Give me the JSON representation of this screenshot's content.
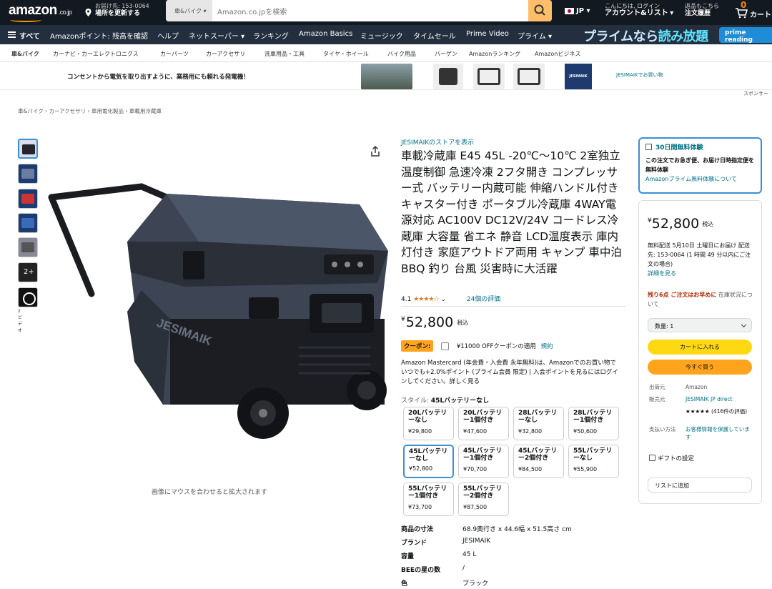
{
  "header": {
    "logo": "amazon",
    "logo_suffix": ".co.jp",
    "deliver_line1": "お届け先: 153-0064",
    "deliver_line2": "場所を更新する",
    "search_category": "車&バイク",
    "search_placeholder": "Amazon.co.jpを検索",
    "language": "JP",
    "account_line1": "こんにちは, ログイン",
    "account_line2": "アカウント&リスト",
    "orders_line1": "返品もこちら",
    "orders_line2": "注文履歴",
    "cart_count": "0",
    "cart_label": "カート"
  },
  "nav": {
    "all": "すべて",
    "items": [
      "Amazonポイント: 残高を確認",
      "ヘルプ",
      "ネットスーパー",
      "ランキング",
      "Amazon Basics",
      "ミュージック",
      "タイムセール",
      "Prime Video",
      "プライム"
    ],
    "promo_a": "プライムなら",
    "promo_b": "読み放題",
    "promo_badge": "prime reading"
  },
  "subnav": [
    "車&バイク",
    "カーナビ・カーエレクトロニクス",
    "カーパーツ",
    "カーアクセサリ",
    "洗車用品・工具",
    "タイヤ・ホイール",
    "バイク用品",
    "バーゲン",
    "Amazonランキング",
    "Amazonビジネス"
  ],
  "ad": {
    "text": "コンセントから電気を取り出すように、業務用にも頼れる発電機！",
    "brand": "JESIMAIK",
    "shop_link": "JESIMAIKでお買い物",
    "sponsored": "スポンサー"
  },
  "breadcrumb": "車&バイク › カーアクセサリ › 車用電化製品 › 車載用冷蔵庫",
  "gallery": {
    "video_label": "2 ビデオ",
    "more_count": "2+",
    "hover_hint": "画像にマウスを合わせると拡大されます"
  },
  "product": {
    "store_link": "JESIMAIKのストアを表示",
    "title": "車載冷蔵庫 E45 45L -20℃～10℃ 2室独立温度制御 急速冷凍 2フタ開き コンプレッサー式 バッテリー内蔵可能 伸縮ハンドル付き キャスター付き ポータブル冷蔵庫 4WAY電源対応 AC100V DC12V/24V コードレス冷蔵庫 大容量 省エネ 静音 LCD温度表示 庫内灯付き 家庭アウトドア両用 キャンプ 車中泊 BBQ 釣り 台風 災害時に大活躍",
    "rating_value": "4.1",
    "stars": "★★★★☆",
    "reviews": "24個の評価",
    "currency": "¥",
    "price": "52,800",
    "tax_label": "税込",
    "coupon_badge": "クーポン:",
    "coupon_text": "¥11000 OFFクーポンの適用",
    "coupon_link": "規約",
    "card_line": "Amazon Mastercard (年会費・入会費 永年無料)は、Amazonでのお買い物で いつでも+2.0%ポイント (プライム会員 限定) | 入会ポイントを見るにはログインしてください。詳しく見る",
    "style_label": "スタイル:",
    "style_value": "45Lバッテリーなし"
  },
  "options": [
    {
      "label": "20Lバッテリーなし",
      "price": "¥29,800"
    },
    {
      "label": "20Lバッテリー1個付き",
      "price": "¥47,600"
    },
    {
      "label": "28Lバッテリーなし",
      "price": "¥32,800"
    },
    {
      "label": "28Lバッテリー1個付き",
      "price": "¥50,600"
    },
    {
      "label": "45Lバッテリーなし",
      "price": "¥52,800"
    },
    {
      "label": "45Lバッテリー1個付き",
      "price": "¥70,700"
    },
    {
      "label": "45Lバッテリー2個付き",
      "price": "¥84,500"
    },
    {
      "label": "55Lバッテリーなし",
      "price": "¥55,900"
    },
    {
      "label": "55Lバッテリー1個付き",
      "price": "¥73,700"
    },
    {
      "label": "55Lバッテリー2個付き",
      "price": "¥87,500"
    }
  ],
  "specs": [
    {
      "k": "商品の寸法",
      "v": "68.9奥行き x 44.6幅 x 51.5高さ cm"
    },
    {
      "k": "ブランド",
      "v": "JESIMAIK"
    },
    {
      "k": "容量",
      "v": "45 L"
    },
    {
      "k": "BEEの星の数",
      "v": "/"
    },
    {
      "k": "色",
      "v": "ブラック"
    }
  ],
  "prime_box": {
    "title": "30日間無料体験",
    "text": "この注文でお急ぎ便、お届け日時指定便を無料体験",
    "link": "Amazonプライム無料体験について"
  },
  "buybox": {
    "currency": "¥",
    "price": "52,800",
    "tax_label": "税込",
    "delivery": "無料配送 5月10日 土曜日にお届け 配送先: 153-0064 (1 時間 49 分以内にご注文の場合)",
    "delivery_link": "詳細を見る",
    "stock": "残り6点 ご注文はお早めに",
    "stock_note": "在庫状況について",
    "quantity": "数量: 1",
    "add_to_cart": "カートに入れる",
    "buy_now": "今すぐ買う",
    "ship_from_label": "出荷元",
    "ship_from": "Amazon",
    "sold_by_label": "販売元",
    "sold_by": "JESIMAIK JP direct",
    "seller_rating": "★★★★★ (416件の評価)",
    "payment_label": "支払い方法",
    "payment": "お客様情報を保護しています",
    "gift": "ギフトの設定",
    "add_list": "リストに追加"
  }
}
